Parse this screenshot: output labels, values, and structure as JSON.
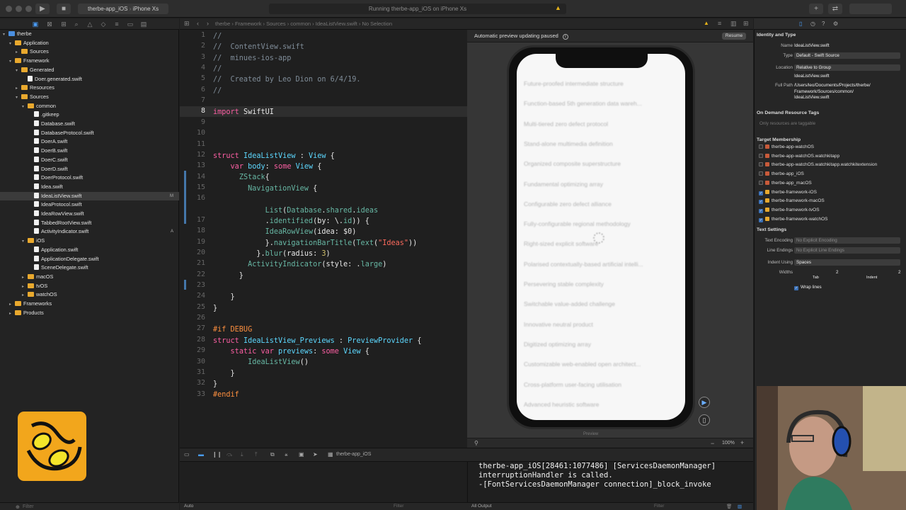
{
  "toolbar": {
    "scheme": "therbe-app_iOS",
    "device": "iPhone Xs",
    "status": "Running therbe-app_iOS on iPhone Xs"
  },
  "jump_bar": [
    "therbe",
    "Framework",
    "Sources",
    "common",
    "IdeaListView.swift",
    "No Selection"
  ],
  "navigator": {
    "rows": [
      {
        "label": "therbe",
        "indent": 0,
        "kind": "project",
        "disc": "▾"
      },
      {
        "label": "Application",
        "indent": 1,
        "kind": "folder",
        "disc": "▾"
      },
      {
        "label": "Sources",
        "indent": 2,
        "kind": "folder",
        "disc": "▸"
      },
      {
        "label": "Framework",
        "indent": 1,
        "kind": "folder",
        "disc": "▾"
      },
      {
        "label": "Generated",
        "indent": 2,
        "kind": "folder",
        "disc": "▾"
      },
      {
        "label": "Doer.generated.swift",
        "indent": 3,
        "kind": "swift",
        "disc": ""
      },
      {
        "label": "Resources",
        "indent": 2,
        "kind": "folder",
        "disc": "▸"
      },
      {
        "label": "Sources",
        "indent": 2,
        "kind": "folder",
        "disc": "▾"
      },
      {
        "label": "common",
        "indent": 3,
        "kind": "folder",
        "disc": "▾"
      },
      {
        "label": ".gitkeep",
        "indent": 4,
        "kind": "swift",
        "disc": ""
      },
      {
        "label": "Database.swift",
        "indent": 4,
        "kind": "swift",
        "disc": ""
      },
      {
        "label": "DatabaseProtocol.swift",
        "indent": 4,
        "kind": "swift",
        "disc": ""
      },
      {
        "label": "DoerA.swift",
        "indent": 4,
        "kind": "swift",
        "disc": ""
      },
      {
        "label": "DoerB.swift",
        "indent": 4,
        "kind": "swift",
        "disc": ""
      },
      {
        "label": "DoerC.swift",
        "indent": 4,
        "kind": "swift",
        "disc": ""
      },
      {
        "label": "DoerD.swift",
        "indent": 4,
        "kind": "swift",
        "disc": ""
      },
      {
        "label": "DoerProtocol.swift",
        "indent": 4,
        "kind": "swift",
        "disc": ""
      },
      {
        "label": "Idea.swift",
        "indent": 4,
        "kind": "swift",
        "disc": ""
      },
      {
        "label": "IdeaListView.swift",
        "indent": 4,
        "kind": "swift",
        "disc": "",
        "selected": true,
        "badge": "M"
      },
      {
        "label": "IdeaProtocol.swift",
        "indent": 4,
        "kind": "swift",
        "disc": ""
      },
      {
        "label": "IdeaRowView.swift",
        "indent": 4,
        "kind": "swift",
        "disc": ""
      },
      {
        "label": "TabbedRootView.swift",
        "indent": 4,
        "kind": "swift",
        "disc": ""
      },
      {
        "label": "ActivityIndicator.swift",
        "indent": 4,
        "kind": "swift",
        "disc": "",
        "badge": "A"
      },
      {
        "label": "iOS",
        "indent": 3,
        "kind": "folder",
        "disc": "▾"
      },
      {
        "label": "Application.swift",
        "indent": 4,
        "kind": "swift",
        "disc": ""
      },
      {
        "label": "ApplicationDelegate.swift",
        "indent": 4,
        "kind": "swift",
        "disc": ""
      },
      {
        "label": "SceneDelegate.swift",
        "indent": 4,
        "kind": "swift",
        "disc": ""
      },
      {
        "label": "macOS",
        "indent": 3,
        "kind": "folder",
        "disc": "▸"
      },
      {
        "label": "tvOS",
        "indent": 3,
        "kind": "folder",
        "disc": "▸"
      },
      {
        "label": "watchOS",
        "indent": 3,
        "kind": "folder",
        "disc": "▸"
      },
      {
        "label": "Frameworks",
        "indent": 1,
        "kind": "folder",
        "disc": "▸"
      },
      {
        "label": "Products",
        "indent": 1,
        "kind": "folder",
        "disc": "▸"
      }
    ],
    "filter_placeholder": "Filter"
  },
  "editor": {
    "line_numbers": [
      "1",
      "2",
      "3",
      "4",
      "5",
      "6",
      "7",
      "8",
      "9",
      "10",
      "11",
      "12",
      "13",
      "14",
      "15",
      "16",
      "",
      "17",
      "18",
      "19",
      "20",
      "21",
      "22",
      "23",
      "24",
      "25",
      "26",
      "27",
      "28",
      "29",
      "30",
      "31",
      "32",
      "33"
    ],
    "current_line": "8"
  },
  "canvas": {
    "notice": "Automatic preview updating paused",
    "resume": "Resume",
    "list_rows": [
      "Future-proofed intermediate structure",
      "Function-based 5th generation data wareh...",
      "Multi-tiered zero defect protocol",
      "Stand-alone multimedia definition",
      "Organized composite superstructure",
      "Fundamental optimizing array",
      "Configurable zero defect alliance",
      "Fully-configurable regional methodology",
      "Right-sized explicit software",
      "Polarised contextually-based artificial intelli...",
      "Persevering stable complexity",
      "Switchable value-added challenge",
      "Innovative neutral product",
      "Digitized optimizing array",
      "Customizable web-enabled open architect...",
      "Cross-platform user-facing utilisation",
      "Advanced heuristic software"
    ],
    "preview_label": "Preview",
    "zoom": "100%"
  },
  "debug": {
    "target": "therbe-app_iOS",
    "auto_label": "Auto",
    "output_label": "All Output",
    "filter_placeholder": "Filter",
    "console_lines": [
      "therbe-app_iOS[28461:1077486] [ServicesDaemonManager]",
      "interruptionHandler is called.",
      "-[FontServicesDaemonManager connection]_block_invoke"
    ]
  },
  "inspector": {
    "identity_title": "Identity and Type",
    "name_label": "Name",
    "name_value": "IdeaListView.swift",
    "type_label": "Type",
    "type_value": "Default - Swift Source",
    "location_label": "Location",
    "location_value": "Relative to Group",
    "location_file": "IdeaListView.swift",
    "fullpath_label": "Full Path",
    "fullpath_value": [
      "/Users/leo/Documents/Projects/therbe/",
      "Framework/Sources/common/",
      "IdeaListView.swift"
    ],
    "odr_title": "On Demand Resource Tags",
    "odr_placeholder": "Only resources are taggable",
    "membership_title": "Target Membership",
    "targets": [
      {
        "name": "therbe-app-watchOS",
        "checked": false
      },
      {
        "name": "therbe-app-watchOS.watchkitapp",
        "checked": false
      },
      {
        "name": "therbe-app-watchOS.watchkitapp.watchkitextension",
        "checked": false
      },
      {
        "name": "therbe-app_iOS",
        "checked": false
      },
      {
        "name": "therbe-app_macOS",
        "checked": false
      },
      {
        "name": "therbe-framework-iOS",
        "checked": true
      },
      {
        "name": "therbe-framework-macOS",
        "checked": true
      },
      {
        "name": "therbe-framework-tvOS",
        "checked": true
      },
      {
        "name": "therbe-framework-watchOS",
        "checked": true
      }
    ],
    "text_title": "Text Settings",
    "encoding_label": "Text Encoding",
    "encoding_value": "No Explicit Encoding",
    "endings_label": "Line Endings",
    "endings_value": "No Explicit Line Endings",
    "indent_label": "Indent Using",
    "indent_value": "Spaces",
    "widths_label": "Widths",
    "tab_value": "2",
    "indent_value_num": "2",
    "tab_label": "Tab",
    "indent_word": "Indent",
    "wrap_label": "Wrap lines"
  }
}
